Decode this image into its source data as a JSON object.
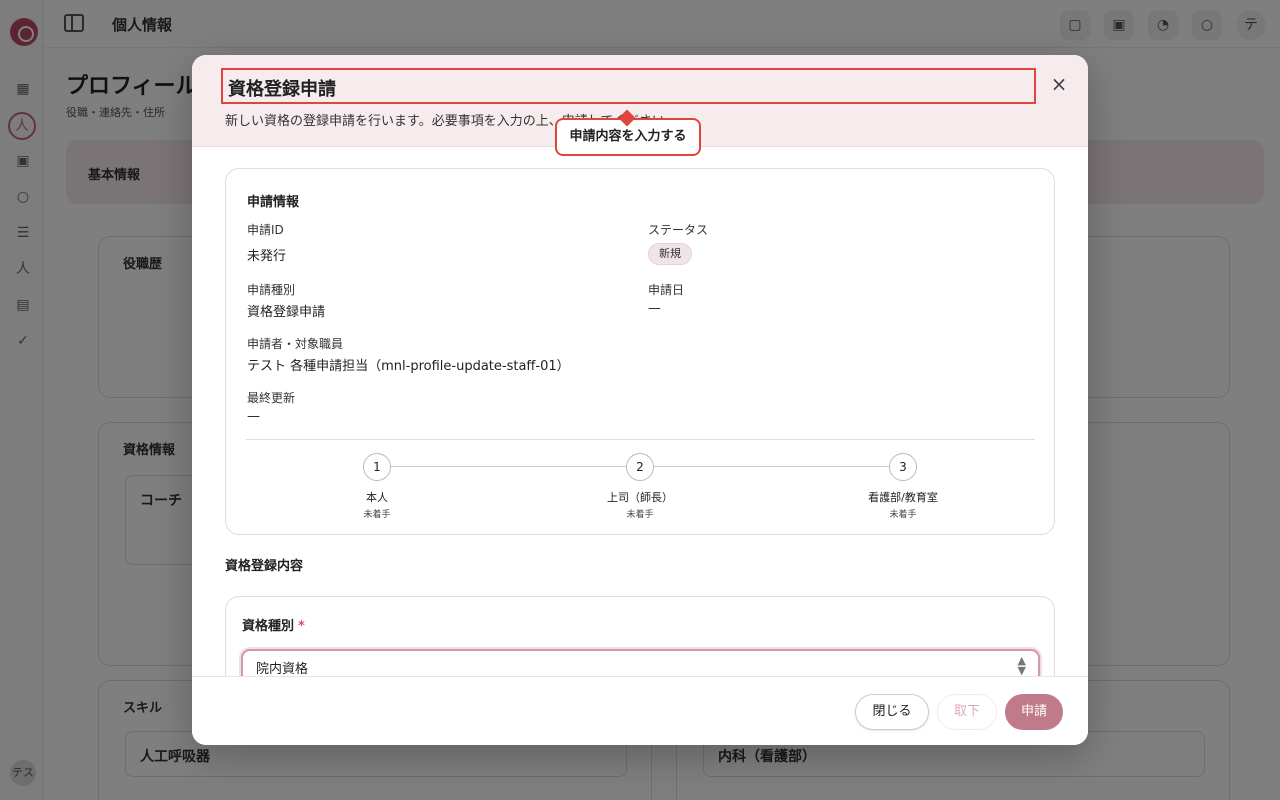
{
  "app": {
    "topbar_title": "個人情報",
    "page_title": "プロフィール",
    "page_subtitle": "役職・連絡先・住所",
    "tab_basic": "基本情報",
    "card_a_title": "役職歴",
    "card_b_title": "資格情報",
    "card_b_item": "コーチ",
    "card_c_title": "スキル",
    "card_c_item": "人工呼吸器",
    "card_d_item": "内科（看護部）",
    "user_initials": "テス",
    "avatar_initial": "テ"
  },
  "modal": {
    "title": "資格登録申請",
    "description": "新しい資格の登録申請を行います。必要事項を入力の上、申請してください。",
    "tooltip": "申請内容を入力する",
    "close_icon": "×"
  },
  "info": {
    "heading": "申請情報",
    "fields": {
      "id_label": "申請ID",
      "id_value": "未発行",
      "status_label": "ステータス",
      "status_value": "新規",
      "type_label": "申請種別",
      "type_value": "資格登録申請",
      "date_label": "申請日",
      "date_value": "—",
      "applicant_label": "申請者・対象職員",
      "applicant_value": "テスト 各種申請担当（mnl-profile-update-staff-01）",
      "updated_label": "最終更新",
      "updated_value": "—"
    },
    "steps": [
      {
        "number": "1",
        "label": "本人",
        "status": "未着手"
      },
      {
        "number": "2",
        "label": "上司（師長）",
        "status": "未着手"
      },
      {
        "number": "3",
        "label": "看護部/教育室",
        "status": "未着手"
      }
    ]
  },
  "form": {
    "section_title": "資格登録内容",
    "type_label": "資格種別",
    "required_mark": "*",
    "type_value": "院内資格"
  },
  "footer": {
    "close_label": "閉じる",
    "withdraw_label": "取下",
    "submit_label": "申請"
  },
  "colors": {
    "accent": "#c07a89",
    "highlight": "#e0453d",
    "header_bg": "#f6ecee"
  }
}
